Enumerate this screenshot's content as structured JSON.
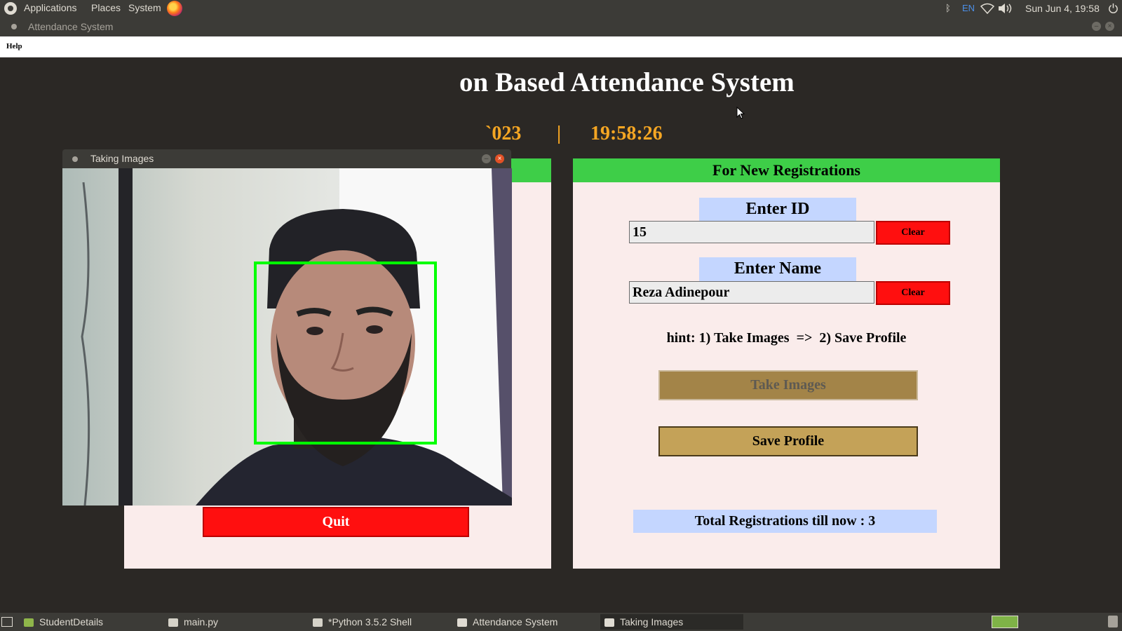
{
  "top_panel": {
    "menus": [
      "Applications",
      "Places",
      "System"
    ],
    "keyboard_layout": "EN",
    "datetime": "Sun Jun  4, 19:58"
  },
  "window": {
    "title": "Attendance System"
  },
  "menubar": {
    "help_label": "Help"
  },
  "app": {
    "title_visible": "on Based Attendance System",
    "date_visible": "`023",
    "separator": "|",
    "time": "19:58:26"
  },
  "registration": {
    "header": "For New Registrations",
    "id_label": "Enter ID",
    "id_value": "15",
    "name_label": "Enter Name",
    "name_value": "Reza Adinepour",
    "clear_label": "Clear",
    "hint": "hint: 1) Take Images  =>  2) Save Profile",
    "take_images_label": "Take Images",
    "save_profile_label": "Save Profile",
    "total_label": "Total Registrations till now  : 3"
  },
  "capture_window": {
    "title": "Taking Images",
    "quit_label": "Quit"
  },
  "taskbar": {
    "items": [
      "StudentDetails",
      "main.py",
      "*Python 3.5.2 Shell",
      "Attendance System",
      "Taking Images"
    ]
  },
  "colors": {
    "panel": "#3c3b37",
    "frame_bg": "#faeceb",
    "frame_header": "#3ece48",
    "label_bg": "#c4d6ff",
    "clear_button": "#ff0f0f",
    "gold_button": "#c4a258",
    "clock": "#f5a623",
    "face_box": "#00ff00"
  }
}
